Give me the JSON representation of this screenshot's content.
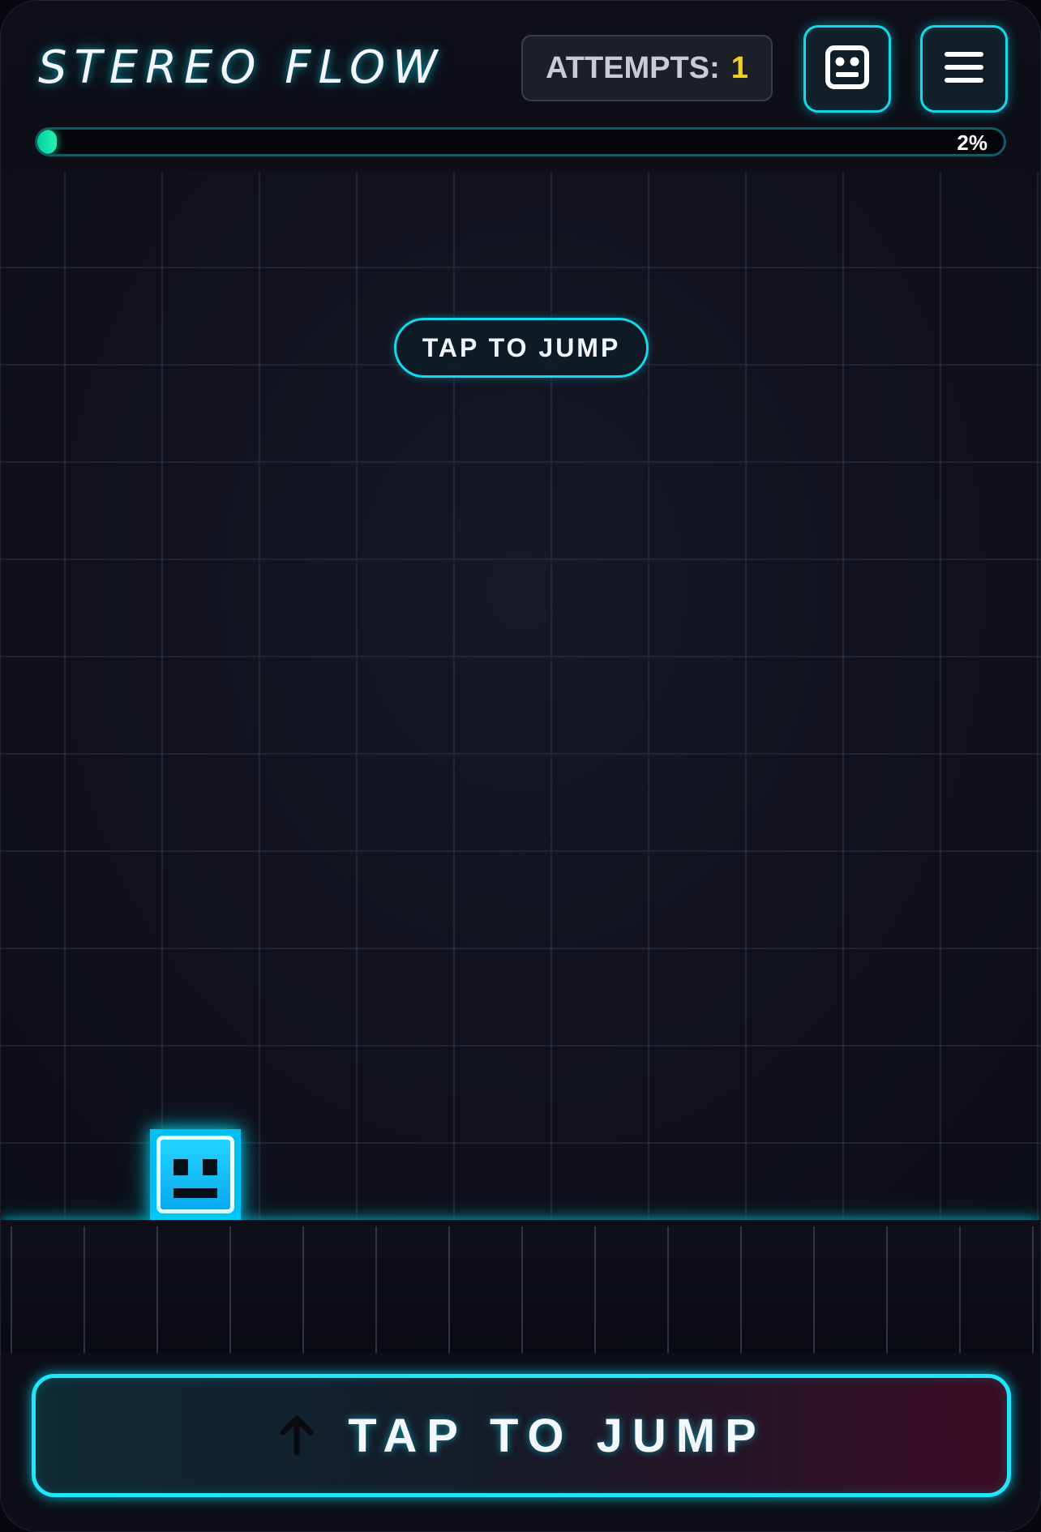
{
  "header": {
    "title": "STEREO FLOW",
    "attempts_label": "ATTEMPTS:",
    "attempts_count": "1"
  },
  "icons": {
    "skin": "robot-face-icon",
    "menu": "hamburger-menu-icon",
    "jump_arrow": "arrow-up-icon"
  },
  "progress": {
    "percent": 2,
    "label": "2%"
  },
  "play_field": {
    "hint": "TAP TO JUMP"
  },
  "controls": {
    "jump_label": "TAP TO JUMP"
  },
  "colors": {
    "accent": "#1fe6fb",
    "progress_fill": "#27f0b6",
    "attempts_count": "#f3d21f",
    "player": "#00bff5",
    "background": "#0d0e17"
  }
}
